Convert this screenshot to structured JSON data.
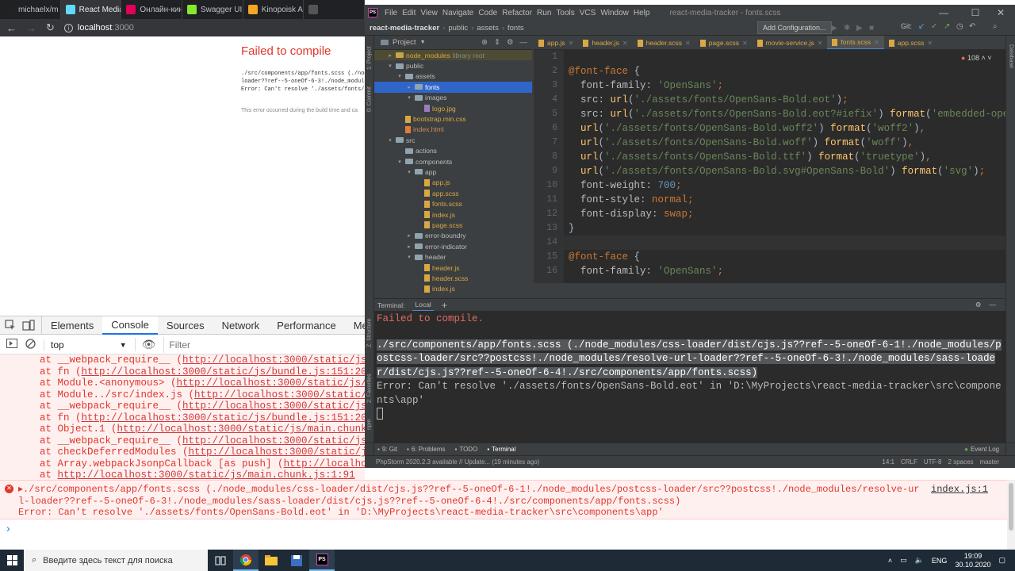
{
  "browser": {
    "tabs": [
      {
        "label": "michaelx/m",
        "color": "#222"
      },
      {
        "label": "React Media",
        "color": "#61dafb"
      },
      {
        "label": "Онлайн-кин",
        "color": "#e2005a"
      },
      {
        "label": "Swagger UI",
        "color": "#85ea2d"
      },
      {
        "label": "Kinopoisk A",
        "color": "#f5a623"
      },
      {
        "label": "",
        "color": "#555"
      }
    ],
    "url_host": "localhost",
    "url_port": ":3000"
  },
  "page": {
    "title": "Failed to compile",
    "box_lines": [
      "./src/components/app/fonts.scss (./node_",
      "loader??ref--5-oneOf-6-3!./node_modul",
      "Error: Can't resolve './assets/fonts/"
    ],
    "note": "This error occurred during the build time and ca"
  },
  "devtools": {
    "tabs": [
      "Elements",
      "Console",
      "Sources",
      "Network",
      "Performance",
      "Me"
    ],
    "context": "top",
    "filter_placeholder": "Filter",
    "stack": [
      {
        "pre": "at __webpack_require__ (",
        "link": "http://localhost:3000/static/js/bundle"
      },
      {
        "pre": "at fn (",
        "link": "http://localhost:3000/static/js/bundle.js:151:20",
        "post": ")"
      },
      {
        "pre": "at Module.<anonymous> (",
        "link": "http://localhost:3000/static/js/main.ch"
      },
      {
        "pre": "at Module../src/index.js (",
        "link": "http://localhost:3000/static/js/mai"
      },
      {
        "pre": "at __webpack_require__ (",
        "link": "http://localhost:3000/static/js/bundle"
      },
      {
        "pre": "at fn (",
        "link": "http://localhost:3000/static/js/bundle.js:151:20",
        "post": ")"
      },
      {
        "pre": "at Object.1 (",
        "link": "http://localhost:3000/static/js/main.chunk.js:968"
      },
      {
        "pre": "at __webpack_require__ (",
        "link": "http://localhost:3000/static/js/bundle"
      },
      {
        "pre": "at checkDeferredModules (",
        "link": "http://localhost:3000/static/js/bundl"
      },
      {
        "pre": "at Array.webpackJsonpCallback [as push] (",
        "link": "http://localhost:300"
      },
      {
        "pre": "at ",
        "link": "http://localhost:3000/static/js/main.chunk.js:1:91",
        "post": ""
      }
    ],
    "error_message": "▸./src/components/app/fonts.scss (./node_modules/css-loader/dist/cjs.js??ref--5-oneOf-6-1!./node_modules/postcss-loader/src??postcss!./node_modules/resolve-url-loader??ref--5-oneOf-6-3!./node_modules/sass-loader/dist/cjs.js??ref--5-oneOf-6-4!./src/components/app/fonts.scss)\nError: Can't resolve './assets/fonts/OpenSans-Bold.eot' in 'D:\\MyProjects\\react-media-tracker\\src\\components\\app'",
    "error_source": "index.js:1",
    "prompt": "›"
  },
  "ide": {
    "menu": [
      "File",
      "Edit",
      "View",
      "Navigate",
      "Code",
      "Refactor",
      "Run",
      "Tools",
      "VCS",
      "Window",
      "Help"
    ],
    "window_title": "react-media-tracker - fonts.scss",
    "breadcrumbs": [
      "react-media-tracker",
      "public",
      "assets",
      "fonts"
    ],
    "add_config": "Add Configuration...",
    "git_label": "Git:",
    "project_label": "Project",
    "left_stripe": [
      "1: Project",
      "0: Commit",
      "Z: Structure",
      "2: Favorites",
      "npm"
    ],
    "right_stripe": "Database",
    "tree": [
      {
        "indent": 1,
        "arrow": "▸",
        "kind": "folder",
        "name": "node_modules",
        "extra": "library root",
        "style": "nm"
      },
      {
        "indent": 1,
        "arrow": "▾",
        "kind": "folder",
        "name": "public"
      },
      {
        "indent": 2,
        "arrow": "▾",
        "kind": "folder",
        "name": "assets"
      },
      {
        "indent": 3,
        "arrow": "▸",
        "kind": "folder",
        "name": "fonts",
        "style": "sel"
      },
      {
        "indent": 3,
        "arrow": "▾",
        "kind": "folder",
        "name": "images"
      },
      {
        "indent": 4,
        "arrow": "",
        "kind": "file",
        "name": "logo.jpg",
        "cls": "fn-jpg"
      },
      {
        "indent": 2,
        "arrow": "",
        "kind": "file",
        "name": "bootstrap.min.css",
        "cls": "fn-css"
      },
      {
        "indent": 2,
        "arrow": "",
        "kind": "file",
        "name": "index.html",
        "cls": "fn-html"
      },
      {
        "indent": 1,
        "arrow": "▾",
        "kind": "folder",
        "name": "src"
      },
      {
        "indent": 2,
        "arrow": "",
        "kind": "folder",
        "name": "actions"
      },
      {
        "indent": 2,
        "arrow": "▾",
        "kind": "folder",
        "name": "components"
      },
      {
        "indent": 3,
        "arrow": "▾",
        "kind": "folder",
        "name": "app"
      },
      {
        "indent": 4,
        "arrow": "",
        "kind": "file",
        "name": "app.js",
        "cls": "fn-js"
      },
      {
        "indent": 4,
        "arrow": "",
        "kind": "file",
        "name": "app.scss",
        "cls": "fn-scss"
      },
      {
        "indent": 4,
        "arrow": "",
        "kind": "file",
        "name": "fonts.scss",
        "cls": "fn-scss"
      },
      {
        "indent": 4,
        "arrow": "",
        "kind": "file",
        "name": "index.js",
        "cls": "fn-js"
      },
      {
        "indent": 4,
        "arrow": "",
        "kind": "file",
        "name": "page.scss",
        "cls": "fn-scss"
      },
      {
        "indent": 3,
        "arrow": "▸",
        "kind": "folder",
        "name": "error-boundry"
      },
      {
        "indent": 3,
        "arrow": "▸",
        "kind": "folder",
        "name": "error-indicator"
      },
      {
        "indent": 3,
        "arrow": "▾",
        "kind": "folder",
        "name": "header"
      },
      {
        "indent": 4,
        "arrow": "",
        "kind": "file",
        "name": "header.js",
        "cls": "fn-js"
      },
      {
        "indent": 4,
        "arrow": "",
        "kind": "file",
        "name": "header.scss",
        "cls": "fn-scss"
      },
      {
        "indent": 4,
        "arrow": "",
        "kind": "file",
        "name": "index.js",
        "cls": "fn-js"
      }
    ],
    "editor_tabs": [
      "app.js",
      "header.js",
      "header.scss",
      "page.scss",
      "movie-service.js",
      "fonts.scss",
      "app.scss"
    ],
    "active_tab": 5,
    "warnings": "108",
    "line_numbers": [
      "1",
      "2",
      "3",
      "4",
      "5",
      "6",
      "7",
      "8",
      "9",
      "10",
      "11",
      "12",
      "13",
      "14",
      "15",
      "16"
    ],
    "code_lines": [
      [],
      [
        [
          "at",
          "@font-face"
        ],
        [
          "t",
          " {"
        ]
      ],
      [
        [
          "t",
          "  "
        ],
        [
          "pr",
          "font-family"
        ],
        [
          "t",
          ": "
        ],
        [
          "st",
          "'OpenSans'"
        ],
        [
          "pu",
          ";"
        ]
      ],
      [
        [
          "t",
          "  "
        ],
        [
          "pr",
          "src"
        ],
        [
          "t",
          ": "
        ],
        [
          "fnc",
          "url"
        ],
        [
          "t",
          "("
        ],
        [
          "st",
          "'./assets/fonts/OpenSans-Bold.eot'"
        ],
        [
          "t",
          ")"
        ],
        [
          "pu",
          ";"
        ]
      ],
      [
        [
          "t",
          "  "
        ],
        [
          "pr",
          "src"
        ],
        [
          "t",
          ": "
        ],
        [
          "fnc",
          "url"
        ],
        [
          "t",
          "("
        ],
        [
          "st",
          "'./assets/fonts/OpenSans-Bold.eot?#iefix'"
        ],
        [
          "t",
          ") "
        ],
        [
          "fnc",
          "format"
        ],
        [
          "t",
          "("
        ],
        [
          "st",
          "'embedded-opentype'"
        ],
        [
          "t",
          ")"
        ],
        [
          "pu",
          ","
        ]
      ],
      [
        [
          "t",
          "  "
        ],
        [
          "fnc",
          "url"
        ],
        [
          "t",
          "("
        ],
        [
          "st",
          "'./assets/fonts/OpenSans-Bold.woff2'"
        ],
        [
          "t",
          ") "
        ],
        [
          "fnc",
          "format"
        ],
        [
          "t",
          "("
        ],
        [
          "st",
          "'woff2'"
        ],
        [
          "t",
          ")"
        ],
        [
          "pu",
          ","
        ]
      ],
      [
        [
          "t",
          "  "
        ],
        [
          "fnc",
          "url"
        ],
        [
          "t",
          "("
        ],
        [
          "st",
          "'./assets/fonts/OpenSans-Bold.woff'"
        ],
        [
          "t",
          ") "
        ],
        [
          "fnc",
          "format"
        ],
        [
          "t",
          "("
        ],
        [
          "st",
          "'woff'"
        ],
        [
          "t",
          ")"
        ],
        [
          "pu",
          ","
        ]
      ],
      [
        [
          "t",
          "  "
        ],
        [
          "fnc",
          "url"
        ],
        [
          "t",
          "("
        ],
        [
          "st",
          "'./assets/fonts/OpenSans-Bold.ttf'"
        ],
        [
          "t",
          ") "
        ],
        [
          "fnc",
          "format"
        ],
        [
          "t",
          "("
        ],
        [
          "st",
          "'truetype'"
        ],
        [
          "t",
          ")"
        ],
        [
          "pu",
          ","
        ]
      ],
      [
        [
          "t",
          "  "
        ],
        [
          "fnc",
          "url"
        ],
        [
          "t",
          "("
        ],
        [
          "st",
          "'./assets/fonts/OpenSans-Bold.svg#OpenSans-Bold'"
        ],
        [
          "t",
          ") "
        ],
        [
          "fnc",
          "format"
        ],
        [
          "t",
          "("
        ],
        [
          "st",
          "'svg'"
        ],
        [
          "t",
          ")"
        ],
        [
          "pu",
          ";"
        ]
      ],
      [
        [
          "t",
          "  "
        ],
        [
          "pr",
          "font-weight"
        ],
        [
          "t",
          ": "
        ],
        [
          "nu",
          "700"
        ],
        [
          "pu",
          ";"
        ]
      ],
      [
        [
          "t",
          "  "
        ],
        [
          "pr",
          "font-style"
        ],
        [
          "t",
          ": "
        ],
        [
          "kw",
          "normal"
        ],
        [
          "pu",
          ";"
        ]
      ],
      [
        [
          "t",
          "  "
        ],
        [
          "pr",
          "font-display"
        ],
        [
          "t",
          ": "
        ],
        [
          "kw",
          "swap"
        ],
        [
          "pu",
          ";"
        ]
      ],
      [
        [
          "t",
          "}"
        ]
      ],
      [],
      [
        [
          "at",
          "@font-face"
        ],
        [
          "t",
          " {"
        ]
      ],
      [
        [
          "t",
          "  "
        ],
        [
          "pr",
          "font-family"
        ],
        [
          "t",
          ": "
        ],
        [
          "st",
          "'OpenSans'"
        ],
        [
          "pu",
          ";"
        ]
      ]
    ],
    "terminal_label": "Terminal:",
    "terminal_tab": "Local",
    "terminal": {
      "line1": "Failed to compile.",
      "highlighted": "./src/components/app/fonts.scss (./node_modules/css-loader/dist/cjs.js??ref--5-oneOf-6-1!./node_modules/postcss-loader/src??postcss!./node_modules/resolve-url-loader??ref--5-oneOf-6-3!./node_modules/sass-loader/dist/cjs.js??ref--5-oneOf-6-4!./src/components/app/fonts.scss)",
      "error": "Error: Can't resolve './assets/fonts/OpenSans-Bold.eot' in 'D:\\MyProjects\\react-media-tracker\\src\\components\\app'"
    },
    "tool_windows": [
      "9: Git",
      "6: Problems",
      "TODO",
      "Terminal"
    ],
    "event_log": "Event Log",
    "status_left": "PhpStorm 2020.2.3 available // Update... (19 minutes ago)",
    "status_right": [
      "14:1",
      "CRLF",
      "UTF-8",
      "2 spaces",
      "master"
    ]
  },
  "taskbar": {
    "search_placeholder": "Введите здесь текст для поиска",
    "lang": "ENG",
    "time": "19:09",
    "date": "30.10.2020"
  }
}
